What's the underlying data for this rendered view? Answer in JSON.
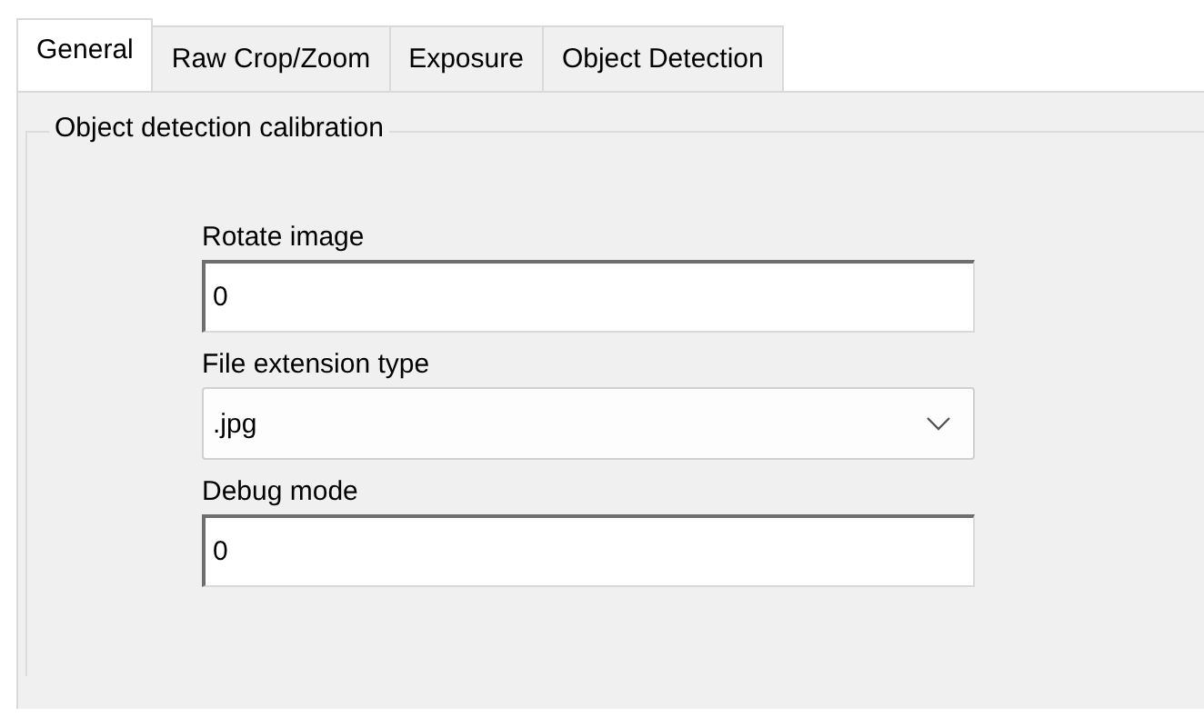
{
  "tabs": [
    {
      "label": "General",
      "selected": true
    },
    {
      "label": "Raw Crop/Zoom",
      "selected": false
    },
    {
      "label": "Exposure",
      "selected": false
    },
    {
      "label": "Object Detection",
      "selected": false
    }
  ],
  "group": {
    "title": "Object detection calibration",
    "fields": [
      {
        "kind": "text",
        "label": "Rotate image",
        "value": "0"
      },
      {
        "kind": "dropdown",
        "label": "File extension type",
        "value": ".jpg"
      },
      {
        "kind": "text",
        "label": "Debug mode",
        "value": "0"
      }
    ]
  }
}
